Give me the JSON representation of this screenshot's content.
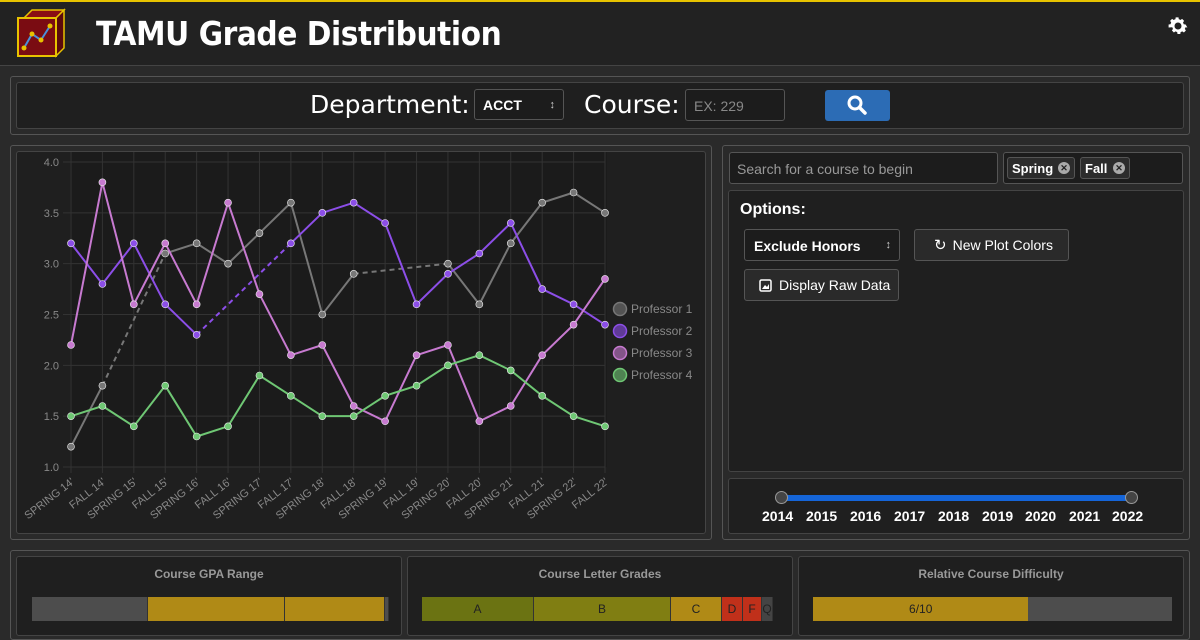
{
  "header": {
    "title": "TAMU Grade Distribution"
  },
  "search": {
    "department_label": "Department:",
    "department_value": "ACCT",
    "course_label": "Course:",
    "course_placeholder": "EX: 229"
  },
  "course_search": {
    "placeholder": "Search for a course to begin"
  },
  "terms": [
    {
      "label": "Spring"
    },
    {
      "label": "Fall"
    }
  ],
  "options": {
    "title": "Options:",
    "honors_select": "Exclude Honors",
    "new_colors_label": "New Plot Colors",
    "raw_data_label": "Display Raw Data"
  },
  "year_range": {
    "years": [
      "2014",
      "2015",
      "2016",
      "2017",
      "2018",
      "2019",
      "2020",
      "2021",
      "2022"
    ],
    "selected": [
      2014,
      2022
    ]
  },
  "cards": {
    "gpa_range": {
      "title": "Course GPA Range",
      "segments": [
        {
          "label": "",
          "color": "#4d4d4d"
        },
        {
          "label": "",
          "color": "#b08a16"
        },
        {
          "label": "",
          "color": "#b08a16"
        },
        {
          "label": "",
          "color": "#4d4d4d"
        }
      ]
    },
    "letter_grades": {
      "title": "Course Letter Grades",
      "segments": [
        {
          "label": "A",
          "color": "#6b7312"
        },
        {
          "label": "B",
          "color": "#807e12"
        },
        {
          "label": "C",
          "color": "#b08a16"
        },
        {
          "label": "D",
          "color": "#c0301a"
        },
        {
          "label": "F",
          "color": "#c0301a"
        },
        {
          "label": "Q",
          "color": "#444444"
        }
      ]
    },
    "difficulty": {
      "title": "Relative Course Difficulty",
      "value_label": "6/10",
      "value": 6,
      "max": 10,
      "fill_color": "#b08a16",
      "empty_color": "#4d4d4d"
    }
  },
  "chart_data": {
    "type": "line",
    "categories": [
      "SPRING 14'",
      "FALL 14'",
      "SPRING 15'",
      "FALL 15'",
      "SPRING 16'",
      "FALL 16'",
      "SPRING 17'",
      "FALL 17'",
      "SPRING 18'",
      "FALL 18'",
      "SPRING 19'",
      "FALL 19'",
      "SPRING 20'",
      "FALL 20'",
      "SPRING 21'",
      "FALL 21'",
      "SPRING 22'",
      "FALL 22'"
    ],
    "ylim": [
      1.0,
      4.0
    ],
    "yticks": [
      "1.0",
      "1.5",
      "2.0",
      "2.5",
      "3.0",
      "3.5",
      "4.0"
    ],
    "grid": true,
    "legend_position": "right",
    "series": [
      {
        "name": "Professor 1",
        "color": "#777777",
        "values": [
          1.2,
          1.8,
          null,
          3.1,
          3.2,
          3.0,
          3.3,
          3.6,
          2.5,
          2.9,
          null,
          null,
          3.0,
          2.6,
          3.2,
          3.6,
          3.7,
          3.5
        ]
      },
      {
        "name": "Professor 2",
        "color": "#8c4ee8",
        "values": [
          3.2,
          2.8,
          3.2,
          2.6,
          2.3,
          null,
          null,
          3.2,
          3.5,
          3.6,
          3.4,
          2.6,
          2.9,
          3.1,
          3.4,
          2.75,
          2.6,
          2.4
        ]
      },
      {
        "name": "Professor 3",
        "color": "#c77ad0",
        "values": [
          2.2,
          3.8,
          2.6,
          3.2,
          2.6,
          3.6,
          2.7,
          2.1,
          2.2,
          1.6,
          1.45,
          2.1,
          2.2,
          1.45,
          1.6,
          2.1,
          2.4,
          2.85
        ]
      },
      {
        "name": "Professor 4",
        "color": "#6fc774",
        "values": [
          1.5,
          1.6,
          1.4,
          1.8,
          1.3,
          1.4,
          1.9,
          1.7,
          1.5,
          1.5,
          1.7,
          1.8,
          2.0,
          2.1,
          1.95,
          1.7,
          1.5,
          1.4
        ]
      }
    ]
  }
}
